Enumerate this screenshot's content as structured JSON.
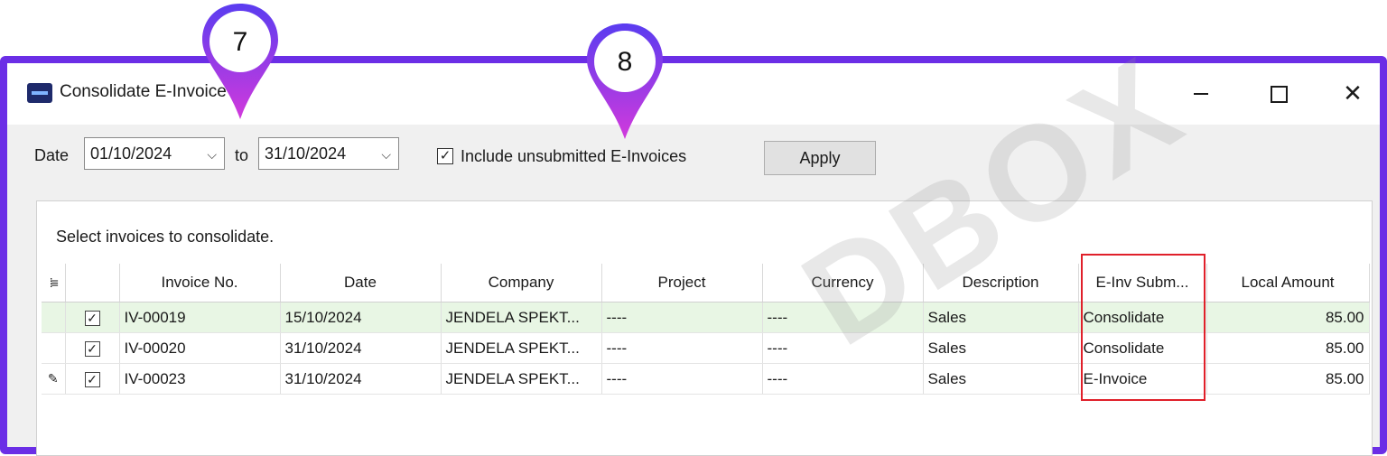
{
  "window": {
    "title": "Consolidate E-Invoice",
    "accent_color": "#6b2ee6"
  },
  "filters": {
    "date_label": "Date",
    "date_from": "01/10/2024",
    "to_label": "to",
    "date_to": "31/10/2024",
    "include_unsubmitted_label": "Include unsubmitted E-Invoices",
    "include_unsubmitted_checked": true,
    "apply_label": "Apply"
  },
  "panel": {
    "instruction": "Select invoices to consolidate."
  },
  "grid": {
    "columns": [
      "Invoice No.",
      "Date",
      "Company",
      "Project",
      "Currency",
      "Description",
      "E-Inv Subm...",
      "Local Amount"
    ],
    "rows": [
      {
        "checked": true,
        "invoice_no": "IV-00019",
        "date": "15/10/2024",
        "company": "JENDELA SPEKT...",
        "project": "----",
        "currency": "----",
        "description": "Sales",
        "einv_submission": "Consolidate",
        "local_amount": "85.00"
      },
      {
        "checked": true,
        "invoice_no": "IV-00020",
        "date": "31/10/2024",
        "company": "JENDELA SPEKT...",
        "project": "----",
        "currency": "----",
        "description": "Sales",
        "einv_submission": "Consolidate",
        "local_amount": "85.00"
      },
      {
        "checked": true,
        "invoice_no": "IV-00023",
        "date": "31/10/2024",
        "company": "JENDELA SPEKT...",
        "project": "----",
        "currency": "----",
        "description": "Sales",
        "einv_submission": "E-Invoice",
        "local_amount": "85.00"
      }
    ]
  },
  "callouts": {
    "pin_7": "7",
    "pin_8": "8",
    "highlight_color": "#e0202a"
  },
  "watermark": "DBOX"
}
